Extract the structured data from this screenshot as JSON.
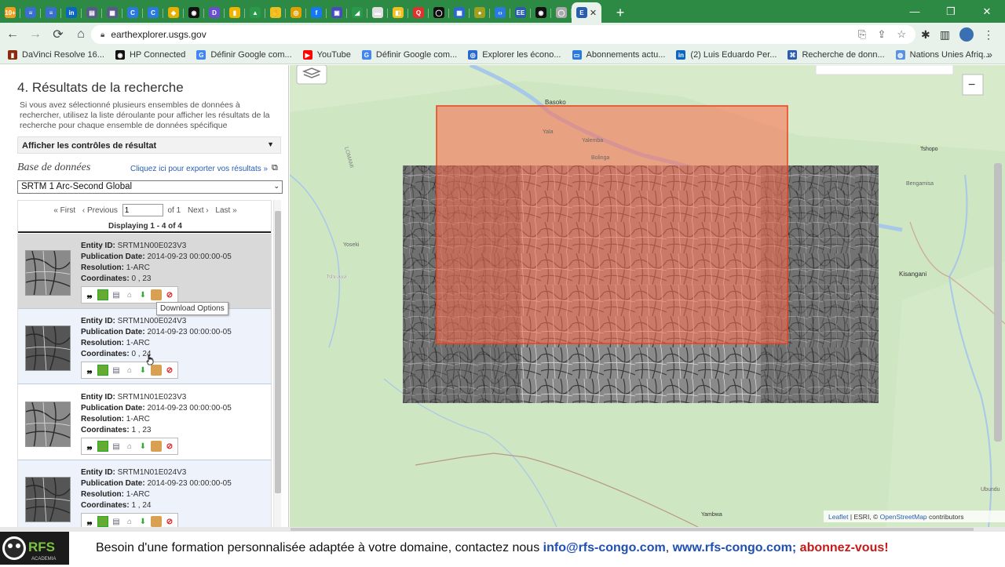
{
  "browser": {
    "tabs": [
      {
        "icon": "tab-favicon",
        "color": "#f0a020",
        "glyph": "10+"
      },
      {
        "icon": "tab-favicon",
        "color": "#3a6fd0",
        "glyph": "≡"
      },
      {
        "icon": "tab-favicon",
        "color": "#3a6fd0",
        "glyph": "≡"
      },
      {
        "icon": "tab-favicon",
        "color": "#0a66c2",
        "glyph": "in"
      },
      {
        "icon": "tab-favicon",
        "color": "#5a5a8a",
        "glyph": "▤"
      },
      {
        "icon": "tab-favicon",
        "color": "#5a5a8a",
        "glyph": "▦"
      },
      {
        "icon": "tab-favicon",
        "color": "#2a7ae2",
        "glyph": "C"
      },
      {
        "icon": "tab-favicon",
        "color": "#2a7ae2",
        "glyph": "C"
      },
      {
        "icon": "tab-favicon",
        "color": "#e6b000",
        "glyph": "◆"
      },
      {
        "icon": "tab-favicon",
        "color": "#111111",
        "glyph": "◉"
      },
      {
        "icon": "tab-favicon",
        "color": "#6a4fd0",
        "glyph": "D"
      },
      {
        "icon": "tab-favicon",
        "color": "#f2b400",
        "glyph": "▮"
      },
      {
        "icon": "tab-favicon",
        "color": "#2a9a4a",
        "glyph": "▲"
      },
      {
        "icon": "tab-favicon",
        "color": "#f0c020",
        "glyph": "✋"
      },
      {
        "icon": "tab-favicon",
        "color": "#e0a000",
        "glyph": "◎"
      },
      {
        "icon": "tab-favicon",
        "color": "#1877f2",
        "glyph": "f"
      },
      {
        "icon": "tab-favicon",
        "color": "#4a4ac0",
        "glyph": "▣"
      },
      {
        "icon": "tab-favicon",
        "color": "#2a9a4a",
        "glyph": "◢"
      },
      {
        "icon": "tab-favicon",
        "color": "#e0e0e0",
        "glyph": "▬"
      },
      {
        "icon": "tab-favicon",
        "color": "#f0c020",
        "glyph": "◧"
      },
      {
        "icon": "tab-favicon",
        "color": "#e03030",
        "glyph": "Q"
      },
      {
        "icon": "tab-favicon",
        "color": "#111111",
        "glyph": "◯"
      },
      {
        "icon": "tab-favicon",
        "color": "#2a6ad0",
        "glyph": "▦"
      },
      {
        "icon": "tab-favicon",
        "color": "#a0a020",
        "glyph": "●"
      },
      {
        "icon": "tab-favicon",
        "color": "#2a7ae2",
        "glyph": "‹›"
      },
      {
        "icon": "tab-favicon",
        "color": "#2a5db0",
        "glyph": "EE"
      },
      {
        "icon": "tab-favicon",
        "color": "#111111",
        "glyph": "◉"
      },
      {
        "icon": "tab-favicon",
        "color": "#aaaaaa",
        "glyph": "◯"
      }
    ],
    "active_tab_glyph": "E",
    "active_tab_close": "✕",
    "new_tab": "+",
    "window_controls": [
      "—",
      "❐",
      "✕"
    ],
    "url": "earthexplorer.usgs.gov",
    "bookmarks": [
      {
        "label": "DaVinci Resolve 16...",
        "color": "#8a2a10",
        "glyph": "▮"
      },
      {
        "label": "HP Connected",
        "color": "#111111",
        "glyph": "◉"
      },
      {
        "label": "Définir Google com...",
        "color": "#4285f4",
        "glyph": "G"
      },
      {
        "label": "YouTube",
        "color": "#ff0000",
        "glyph": "▶"
      },
      {
        "label": "Définir Google com...",
        "color": "#4285f4",
        "glyph": "G"
      },
      {
        "label": "Explorer les écono...",
        "color": "#2a6ad0",
        "glyph": "◎"
      },
      {
        "label": "Abonnements actu...",
        "color": "#2a7ae2",
        "glyph": "▭"
      },
      {
        "label": "(2) Luis Eduardo Per...",
        "color": "#0a66c2",
        "glyph": "in"
      },
      {
        "label": "Recherche de donn...",
        "color": "#2a5db0",
        "glyph": "⌘"
      },
      {
        "label": "Nations Unies Afriq...",
        "color": "#5b92e5",
        "glyph": "◍"
      }
    ],
    "bookmarks_more": "»"
  },
  "sidebar": {
    "title": "4. Résultats de la recherche",
    "description": "Si vous avez sélectionné plusieurs ensembles de données à rechercher, utilisez la liste déroulante pour afficher les résultats de la recherche pour chaque ensemble de données spécifique",
    "controls_label": "Afficher les contrôles de résultat",
    "database_label": "Base de données",
    "export_link": "Cliquez ici pour exporter vos résultats »",
    "dataset_selected": "SRTM 1 Arc-Second Global",
    "pager": {
      "first": "« First",
      "previous": "‹ Previous",
      "page_value": "1",
      "of_pages": "of 1",
      "next": "Next ›",
      "last": "Last »"
    },
    "displaying": "Displaying 1 - 4 of 4",
    "results": [
      {
        "entity_label": "Entity ID:",
        "entity_id": "SRTM1N00E023V3",
        "pub_label": "Publication Date:",
        "pub_date": "2014-09-23 00:00:00-05",
        "res_label": "Resolution:",
        "resolution": "1-ARC",
        "coord_label": "Coordinates:",
        "coordinates": "0 , 23"
      },
      {
        "entity_label": "Entity ID:",
        "entity_id": "SRTM1N00E024V3",
        "pub_label": "Publication Date:",
        "pub_date": "2014-09-23 00:00:00-05",
        "res_label": "Resolution:",
        "resolution": "1-ARC",
        "coord_label": "Coordinates:",
        "coordinates": "0 , 24"
      },
      {
        "entity_label": "Entity ID:",
        "entity_id": "SRTM1N01E023V3",
        "pub_label": "Publication Date:",
        "pub_date": "2014-09-23 00:00:00-05",
        "res_label": "Resolution:",
        "resolution": "1-ARC",
        "coord_label": "Coordinates:",
        "coordinates": "1 , 23"
      },
      {
        "entity_label": "Entity ID:",
        "entity_id": "SRTM1N01E024V3",
        "pub_label": "Publication Date:",
        "pub_date": "2014-09-23 00:00:00-05",
        "res_label": "Resolution:",
        "resolution": "1-ARC",
        "coord_label": "Coordinates:",
        "coordinates": "1 , 24"
      }
    ],
    "tooltip": "Download Options"
  },
  "map": {
    "labels": {
      "basoko": "Basoko",
      "yala": "Yala",
      "yalemba": "Yalemba",
      "bolinga": "Bolinga",
      "yoseki": "Yoseki",
      "tshuapa": "Tshuapa",
      "tshopo": "Tshopo",
      "bengamisa": "Bengamisa",
      "kisangani": "Kisangani",
      "yambwa": "Yambwa",
      "lomami": "LOMAMI",
      "ubundu": "Ubundu"
    },
    "zoom_out": "−",
    "attribution_leaflet": "Leaflet",
    "attribution_mid": " | ESRI, © ",
    "attribution_osm": "OpenStreetMap",
    "attribution_end": " contributors",
    "colors": {
      "footprint_fill": "#ff6a4d",
      "footprint_stroke": "#e8421e",
      "land": "#cfe6c2",
      "river": "#a7c8e8"
    }
  },
  "footer": {
    "logo_text": "RFS",
    "logo_sub": "ACADEMIA",
    "text_prefix": "Besoin d'une formation personnalisée adaptée à votre domaine, contactez nous ",
    "email": "info@rfs-congo.com",
    "comma": ", ",
    "website": "www.rfs-congo.com;",
    "subscribe": " abonnez-vous!"
  }
}
